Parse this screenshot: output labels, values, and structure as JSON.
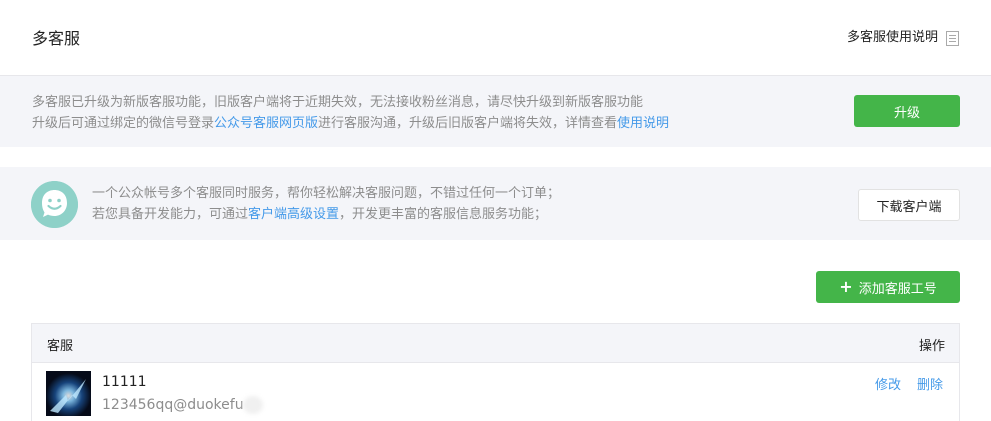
{
  "header": {
    "title": "多客服",
    "help_label": "多客服使用说明",
    "help_icon": "document-icon"
  },
  "notice": {
    "line1": "多客服已升级为新版客服功能，旧版客户端将于近期失效，无法接收粉丝消息，请尽快升级到新版客服功能",
    "line2_prefix": "升级后可通过绑定的微信号登录",
    "line2_link1": "公众号客服网页版",
    "line2_middle": "进行客服沟通，升级后旧版客户端将失效，详情查看",
    "line2_link2": "使用说明",
    "upgrade_label": "升级"
  },
  "intro": {
    "icon": "smiley-icon",
    "line1": "一个公众帐号多个客服同时服务，帮你轻松解决客服问题，不错过任何一个订单；",
    "line2_prefix": "若您具备开发能力，可通过",
    "line2_link": "客户端高级设置",
    "line2_suffix": "，开发更丰富的客服信息服务功能；",
    "download_label": "下载客户端"
  },
  "add_button": {
    "icon": "plus-icon",
    "label": "添加客服工号"
  },
  "table": {
    "columns": [
      "客服",
      "操作"
    ],
    "rows": [
      {
        "name": "11111",
        "account": "123456qq@duokefu",
        "avatar": "avatar-image",
        "actions": [
          "修改",
          "删除"
        ]
      }
    ]
  },
  "colors": {
    "accent_green": "#44b549",
    "link_blue": "#459ae9",
    "panel_bg": "#f4f5f9",
    "muted_text": "#8d8d8d",
    "smiley_teal": "#8ed1c8"
  }
}
